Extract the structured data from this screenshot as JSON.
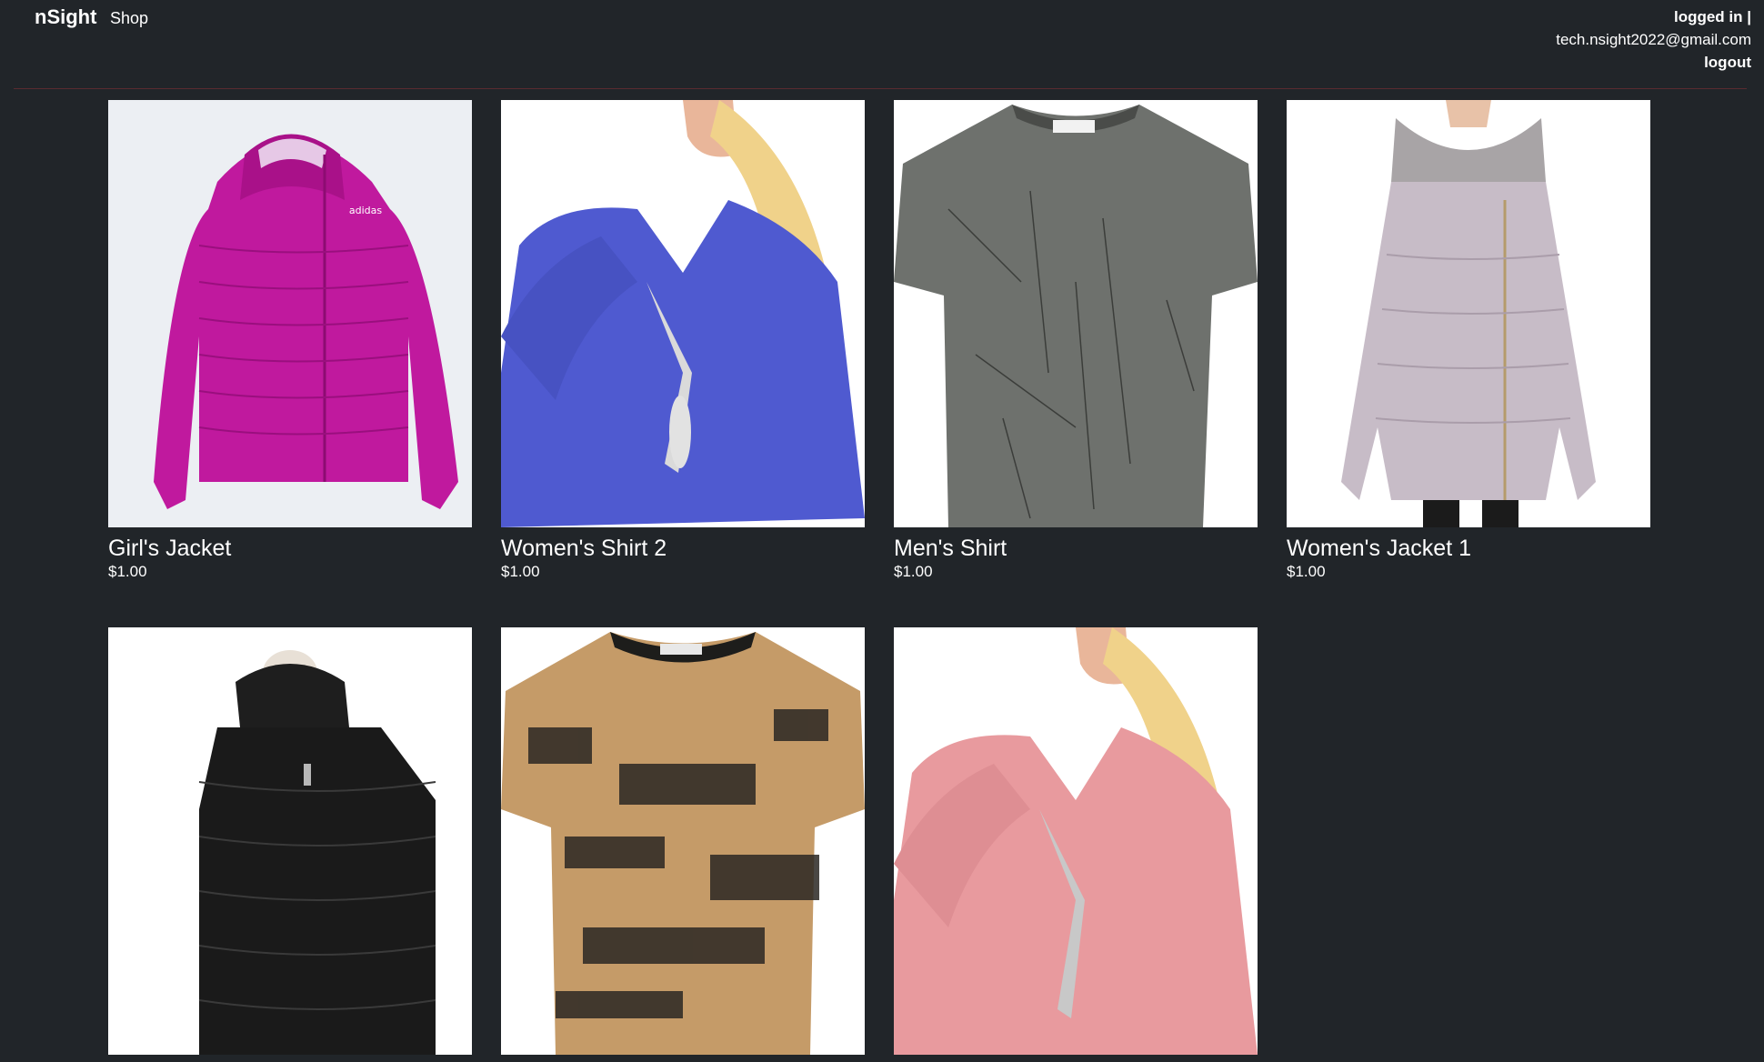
{
  "nav": {
    "brand": "nSight",
    "shop": "Shop",
    "logged_in": "logged in |",
    "email": "tech.nsight2022@gmail.com",
    "logout": "logout"
  },
  "products": [
    {
      "title": "Girl's Jacket",
      "price": "$1.00",
      "image": "magenta-puffer-jacket"
    },
    {
      "title": "Women's Shirt 2",
      "price": "$1.00",
      "image": "blue-vneck-shirt"
    },
    {
      "title": "Men's Shirt",
      "price": "$1.00",
      "image": "gray-tshirt"
    },
    {
      "title": "Women's Jacket 1",
      "price": "$1.00",
      "image": "lilac-puffer-coat"
    },
    {
      "title": "",
      "price": "",
      "image": "black-puffer-jacket"
    },
    {
      "title": "",
      "price": "",
      "image": "tan-black-tshirt"
    },
    {
      "title": "",
      "price": "",
      "image": "pink-vneck-shirt"
    }
  ],
  "colors": {
    "background": "#212529",
    "text": "#ffffff",
    "divider": "#5a2b30"
  }
}
